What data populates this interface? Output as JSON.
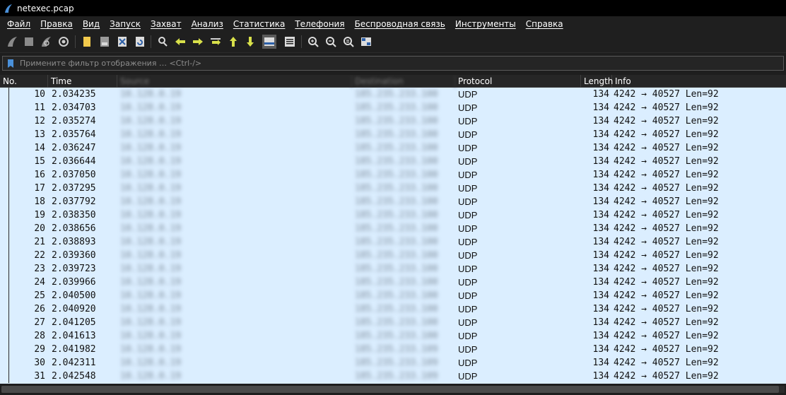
{
  "window": {
    "title": "netexec.pcap"
  },
  "menu": [
    "Файл",
    "Правка",
    "Вид",
    "Запуск",
    "Захват",
    "Анализ",
    "Статистика",
    "Телефония",
    "Беспроводная связь",
    "Инструменты",
    "Справка"
  ],
  "toolbar": {
    "icons": [
      "shark-fin-start-icon",
      "stop-capture-icon",
      "restart-capture-icon",
      "capture-options-icon",
      "open-file-icon",
      "save-file-icon",
      "close-file-icon",
      "reload-file-icon",
      "find-packet-icon",
      "go-back-icon",
      "go-forward-icon",
      "go-to-packet-icon",
      "go-first-icon",
      "go-last-icon",
      "autoscroll-icon",
      "colorize-icon",
      "zoom-in-icon",
      "zoom-out-icon",
      "normal-size-icon",
      "resize-columns-icon"
    ]
  },
  "filter": {
    "placeholder": "Примените фильтр отображения … <Ctrl-/>"
  },
  "columns": {
    "no": "No.",
    "time": "Time",
    "source": "Source",
    "destination": "Destination",
    "protocol": "Protocol",
    "length": "Length",
    "info": "Info"
  },
  "packets": [
    {
      "no": "10",
      "time": "2.034235",
      "src": "10.128.0.19",
      "dst": "185.235.233.100",
      "proto": "UDP",
      "len": "134",
      "info": "4242 → 40527 Len=92"
    },
    {
      "no": "11",
      "time": "2.034703",
      "src": "10.128.0.19",
      "dst": "185.235.233.100",
      "proto": "UDP",
      "len": "134",
      "info": "4242 → 40527 Len=92"
    },
    {
      "no": "12",
      "time": "2.035274",
      "src": "10.128.0.19",
      "dst": "185.235.233.100",
      "proto": "UDP",
      "len": "134",
      "info": "4242 → 40527 Len=92"
    },
    {
      "no": "13",
      "time": "2.035764",
      "src": "10.128.0.19",
      "dst": "185.235.233.100",
      "proto": "UDP",
      "len": "134",
      "info": "4242 → 40527 Len=92"
    },
    {
      "no": "14",
      "time": "2.036247",
      "src": "10.128.0.19",
      "dst": "185.235.233.100",
      "proto": "UDP",
      "len": "134",
      "info": "4242 → 40527 Len=92"
    },
    {
      "no": "15",
      "time": "2.036644",
      "src": "10.128.0.19",
      "dst": "185.235.233.100",
      "proto": "UDP",
      "len": "134",
      "info": "4242 → 40527 Len=92"
    },
    {
      "no": "16",
      "time": "2.037050",
      "src": "10.128.0.19",
      "dst": "185.235.233.100",
      "proto": "UDP",
      "len": "134",
      "info": "4242 → 40527 Len=92"
    },
    {
      "no": "17",
      "time": "2.037295",
      "src": "10.128.0.19",
      "dst": "185.235.233.100",
      "proto": "UDP",
      "len": "134",
      "info": "4242 → 40527 Len=92"
    },
    {
      "no": "18",
      "time": "2.037792",
      "src": "10.128.0.19",
      "dst": "185.235.233.100",
      "proto": "UDP",
      "len": "134",
      "info": "4242 → 40527 Len=92"
    },
    {
      "no": "19",
      "time": "2.038350",
      "src": "10.128.0.19",
      "dst": "185.235.233.100",
      "proto": "UDP",
      "len": "134",
      "info": "4242 → 40527 Len=92"
    },
    {
      "no": "20",
      "time": "2.038656",
      "src": "10.128.0.19",
      "dst": "185.235.233.100",
      "proto": "UDP",
      "len": "134",
      "info": "4242 → 40527 Len=92"
    },
    {
      "no": "21",
      "time": "2.038893",
      "src": "10.128.0.19",
      "dst": "185.235.233.100",
      "proto": "UDP",
      "len": "134",
      "info": "4242 → 40527 Len=92"
    },
    {
      "no": "22",
      "time": "2.039360",
      "src": "10.128.0.19",
      "dst": "185.235.233.100",
      "proto": "UDP",
      "len": "134",
      "info": "4242 → 40527 Len=92"
    },
    {
      "no": "23",
      "time": "2.039723",
      "src": "10.128.0.19",
      "dst": "185.235.233.100",
      "proto": "UDP",
      "len": "134",
      "info": "4242 → 40527 Len=92"
    },
    {
      "no": "24",
      "time": "2.039966",
      "src": "10.128.0.19",
      "dst": "185.235.233.100",
      "proto": "UDP",
      "len": "134",
      "info": "4242 → 40527 Len=92"
    },
    {
      "no": "25",
      "time": "2.040500",
      "src": "10.128.0.19",
      "dst": "185.235.233.100",
      "proto": "UDP",
      "len": "134",
      "info": "4242 → 40527 Len=92"
    },
    {
      "no": "26",
      "time": "2.040920",
      "src": "10.128.0.19",
      "dst": "185.235.233.100",
      "proto": "UDP",
      "len": "134",
      "info": "4242 → 40527 Len=92"
    },
    {
      "no": "27",
      "time": "2.041205",
      "src": "10.128.0.19",
      "dst": "185.235.233.100",
      "proto": "UDP",
      "len": "134",
      "info": "4242 → 40527 Len=92"
    },
    {
      "no": "28",
      "time": "2.041613",
      "src": "10.128.0.19",
      "dst": "185.235.233.100",
      "proto": "UDP",
      "len": "134",
      "info": "4242 → 40527 Len=92"
    },
    {
      "no": "29",
      "time": "2.041982",
      "src": "10.128.0.19",
      "dst": "185.235.233.109",
      "proto": "UDP",
      "len": "134",
      "info": "4242 → 40527 Len=92"
    },
    {
      "no": "30",
      "time": "2.042311",
      "src": "10.128.0.19",
      "dst": "185.235.233.109",
      "proto": "UDP",
      "len": "134",
      "info": "4242 → 40527 Len=92"
    },
    {
      "no": "31",
      "time": "2.042548",
      "src": "10.128.0.19",
      "dst": "185.235.233.109",
      "proto": "UDP",
      "len": "134",
      "info": "4242 → 40527 Len=92"
    }
  ],
  "colors": {
    "rowBackground": "#dbeeff",
    "chrome": "#1f1f1f",
    "accent": "#4a90d9"
  }
}
